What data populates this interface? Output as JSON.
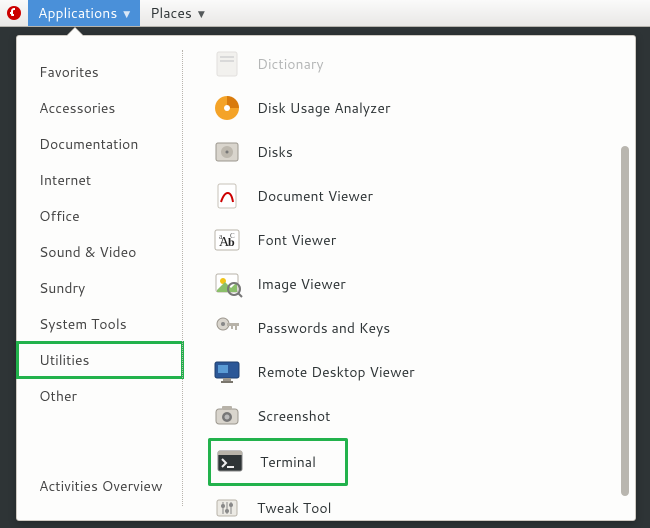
{
  "topbar": {
    "applications_label": "Applications",
    "places_label": "Places"
  },
  "sidebar": {
    "categories": [
      "Favorites",
      "Accessories",
      "Documentation",
      "Internet",
      "Office",
      "Sound & Video",
      "Sundry",
      "System Tools",
      "Utilities",
      "Other"
    ],
    "selected_index": 8,
    "overview_label": "Activities Overview"
  },
  "apps": [
    {
      "icon": "dictionary-icon",
      "label": "Dictionary",
      "faded": true
    },
    {
      "icon": "disk-usage-icon",
      "label": "Disk Usage Analyzer"
    },
    {
      "icon": "disks-icon",
      "label": "Disks"
    },
    {
      "icon": "document-viewer-icon",
      "label": "Document Viewer"
    },
    {
      "icon": "font-viewer-icon",
      "label": "Font Viewer"
    },
    {
      "icon": "image-viewer-icon",
      "label": "Image Viewer"
    },
    {
      "icon": "passwords-keys-icon",
      "label": "Passwords and Keys"
    },
    {
      "icon": "remote-desktop-icon",
      "label": "Remote Desktop Viewer"
    },
    {
      "icon": "screenshot-icon",
      "label": "Screenshot"
    },
    {
      "icon": "terminal-icon",
      "label": "Terminal",
      "highlight": true
    },
    {
      "icon": "tweak-tool-icon",
      "label": "Tweak Tool"
    }
  ]
}
